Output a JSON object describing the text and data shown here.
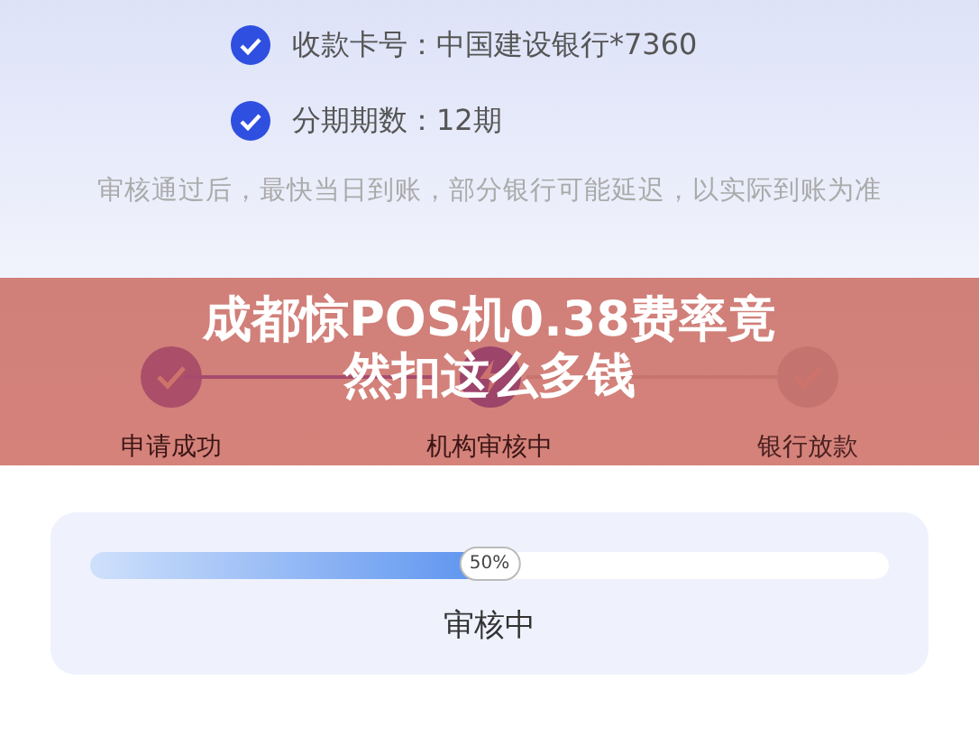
{
  "details": [
    {
      "text": "收款卡号：中国建设银行*7360",
      "checked": true
    },
    {
      "text": "分期期数：12期",
      "checked": true
    }
  ],
  "note": "审核通过后，最快当日到账，部分银行可能延迟，以实际到账为准",
  "steps": [
    {
      "label": "申请成功",
      "completed": true,
      "current": false
    },
    {
      "label": "机构审核中",
      "completed": false,
      "current": true
    },
    {
      "label": "银行放款",
      "completed": false,
      "current": false
    }
  ],
  "progress": {
    "level": 0.5,
    "reading": "50%",
    "status": "审核中"
  },
  "banner": {
    "title": "成都惊POS机0.38费率竟然扣这么多钱"
  }
}
